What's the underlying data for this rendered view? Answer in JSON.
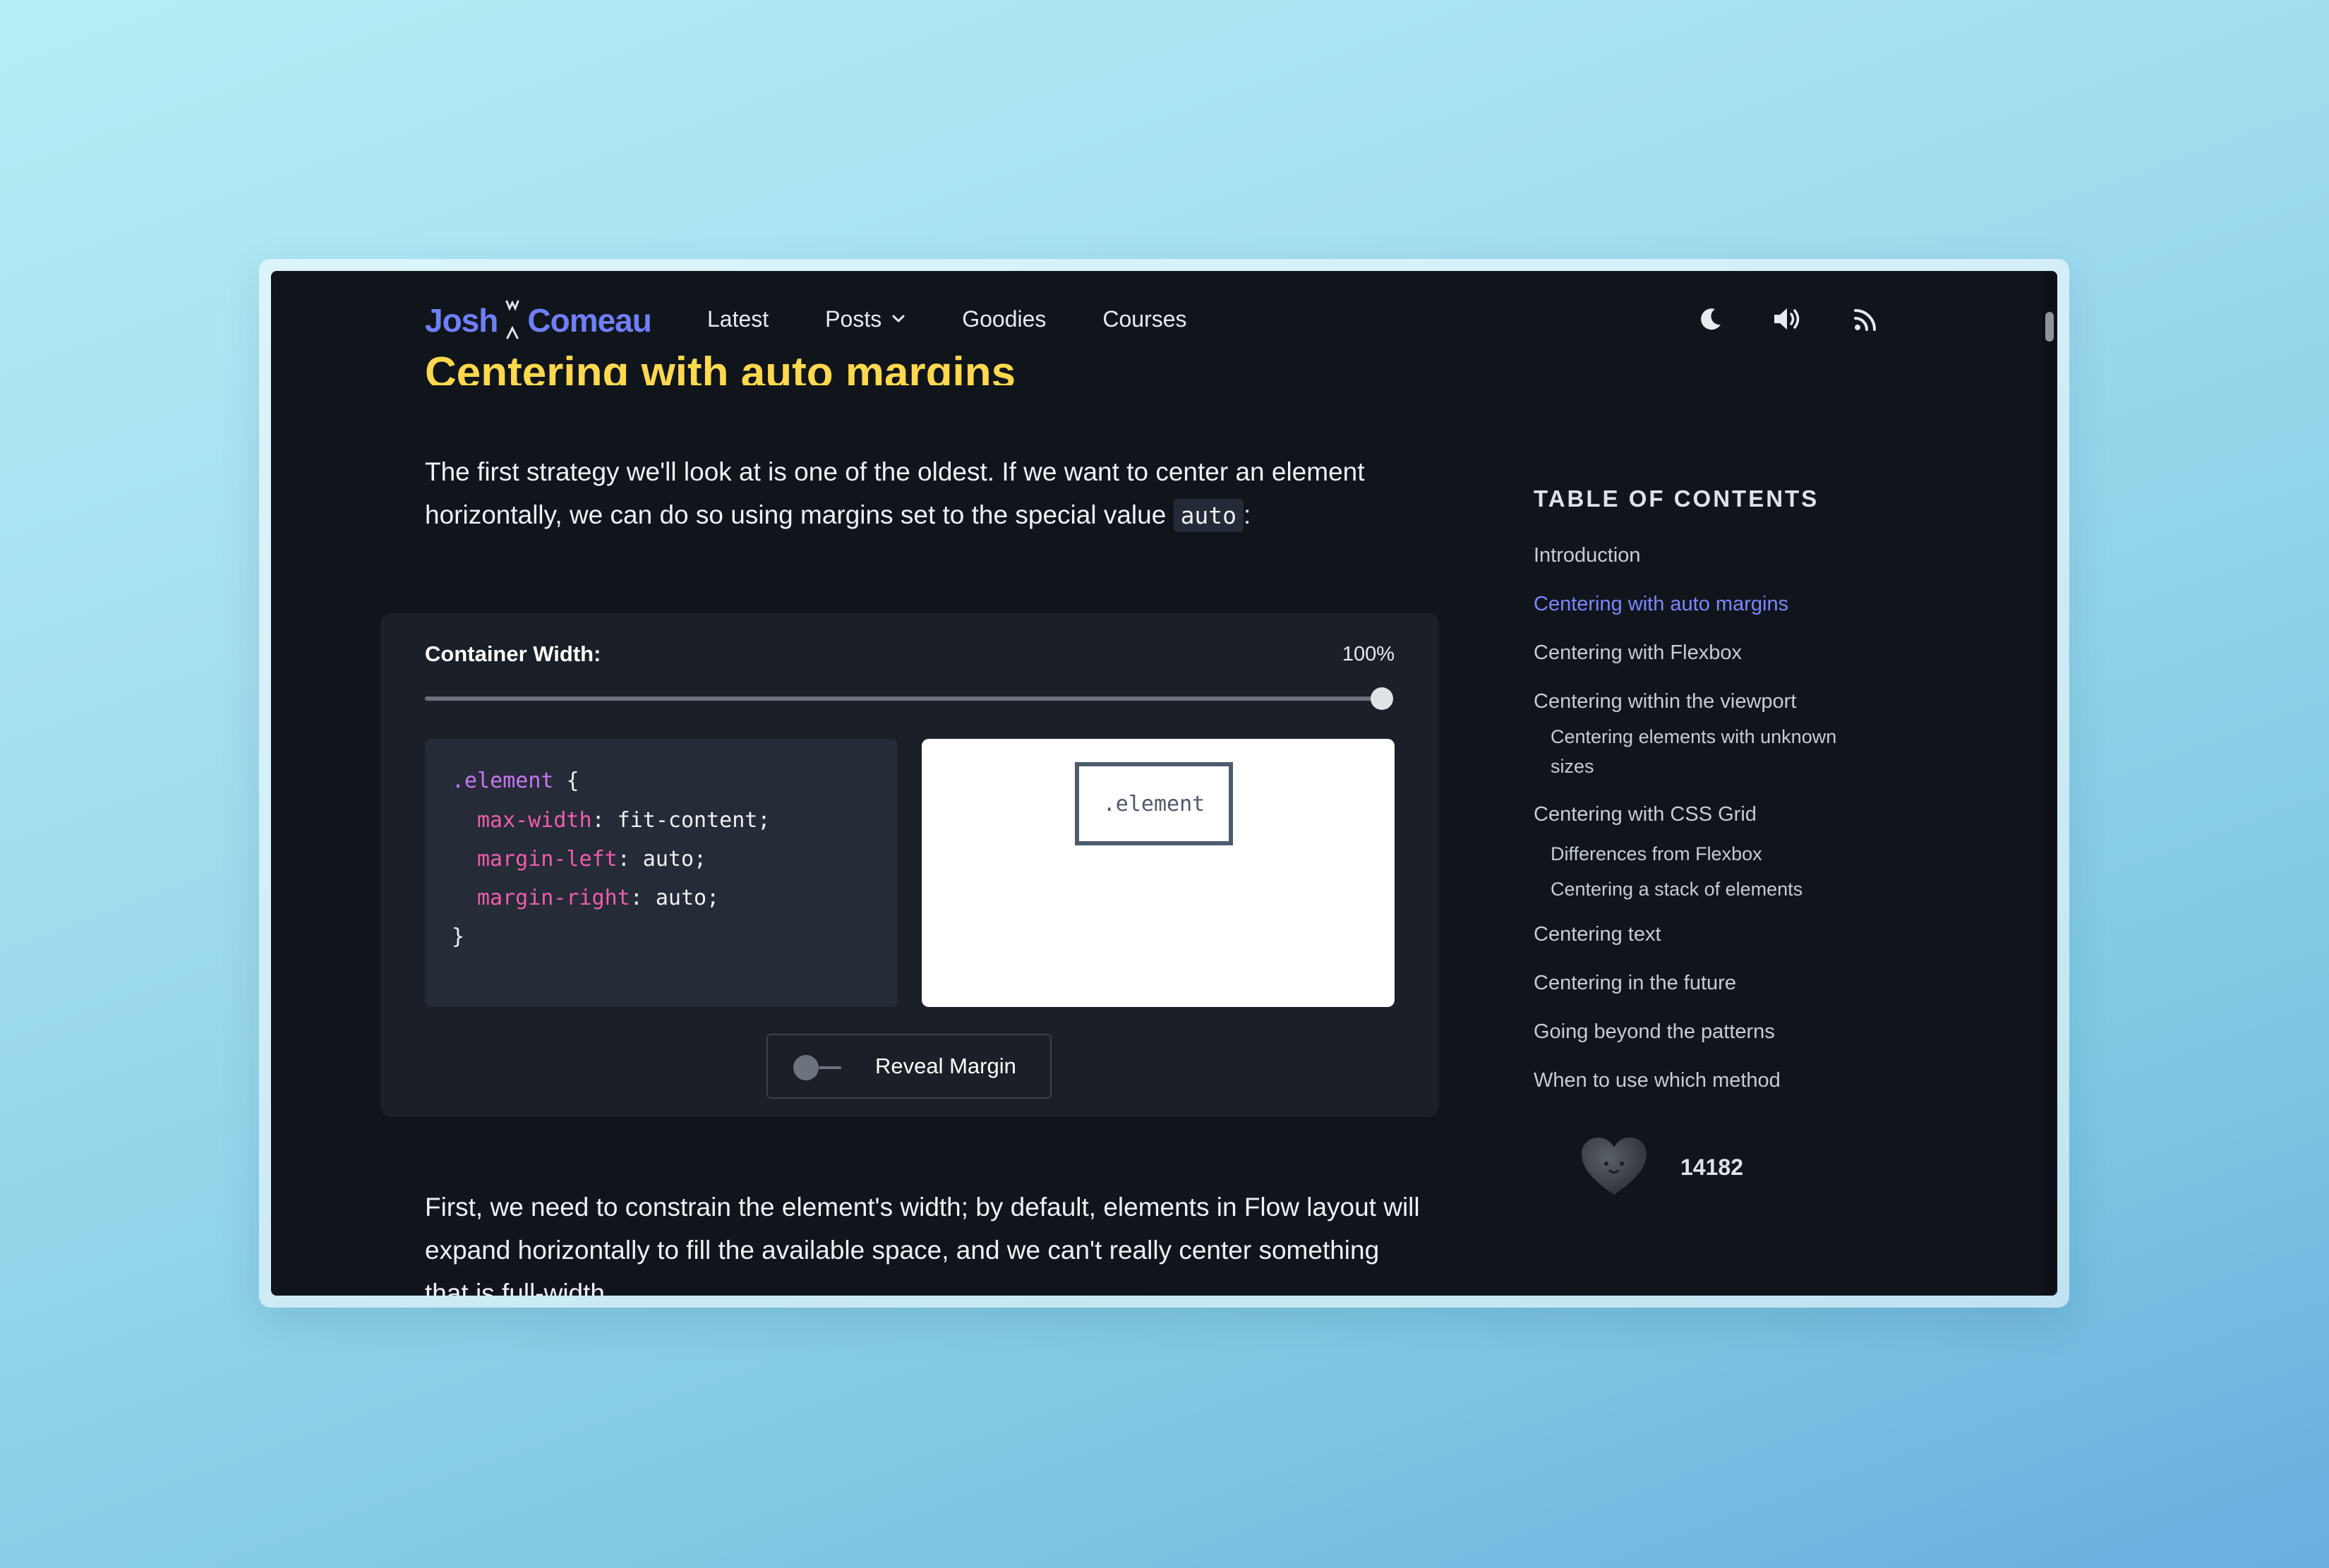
{
  "header": {
    "logo_first": "Josh",
    "logo_second": "Comeau",
    "nav": [
      {
        "label": "Latest"
      },
      {
        "label": "Posts"
      },
      {
        "label": "Goodies"
      },
      {
        "label": "Courses"
      }
    ],
    "icons": [
      "moon-icon",
      "volume-icon",
      "rss-icon"
    ]
  },
  "article": {
    "title": "Centering with auto margins",
    "para1_text": "The first strategy we'll look at is one of the oldest. If we want to center an element horizontally, we can do so using margins set to the special value ",
    "para1_code": "auto",
    "para1_end": ":",
    "para2_text": "First, we need to constrain the element's width; by default, elements in Flow layout will expand horizontally to fill the available space, and we can't really center something that is full-width."
  },
  "demo": {
    "label": "Container Width:",
    "value_text": "100%",
    "value": 1.0,
    "code": {
      "selector": ".element",
      "open": " {",
      "rules": [
        {
          "prop": "max-width",
          "value": " fit-content;"
        },
        {
          "prop": "margin-left",
          "value": " auto;"
        },
        {
          "prop": "margin-right",
          "value": " auto;"
        }
      ],
      "close": "}"
    },
    "preview_label": ".element",
    "toggle_label": "Reveal Margin",
    "toggle_on": false
  },
  "toc": {
    "heading": "TABLE OF CONTENTS",
    "items": [
      {
        "label": "Introduction",
        "active": false
      },
      {
        "label": "Centering with auto margins",
        "active": true
      },
      {
        "label": "Centering with Flexbox",
        "active": false
      },
      {
        "label": "Centering within the viewport",
        "active": false
      },
      {
        "label": "Centering elements with unknown",
        "sub": true
      },
      {
        "label": "sizes",
        "sub": true
      },
      {
        "label": "Centering with CSS Grid",
        "active": false
      },
      {
        "label": "Differences from Flexbox",
        "sub": true
      },
      {
        "label": "Centering a stack of elements",
        "sub": true
      },
      {
        "label": "Centering text",
        "active": false
      },
      {
        "label": "Centering in the future",
        "active": false
      },
      {
        "label": "Going beyond the patterns",
        "active": false
      },
      {
        "label": "When to use which method",
        "active": false
      }
    ]
  },
  "likes": {
    "count": "14182"
  },
  "colors": {
    "title": "#ffd84d",
    "accent": "#7b86ff",
    "selector": "#c776f2",
    "property": "#ef5da8",
    "background": "#10151c"
  }
}
